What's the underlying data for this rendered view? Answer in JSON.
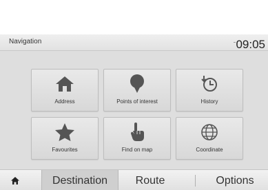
{
  "statusbar": {
    "title": "Navigation",
    "signal": "․․․",
    "time": "09:05"
  },
  "tiles": [
    {
      "label": "Address",
      "icon": "home-icon"
    },
    {
      "label": "Points of interest",
      "icon": "poi-marker-icon"
    },
    {
      "label": "History",
      "icon": "history-clock-icon"
    },
    {
      "label": "Favourites",
      "icon": "star-icon"
    },
    {
      "label": "Find on map",
      "icon": "pointing-hand-icon"
    },
    {
      "label": "Coordinate",
      "icon": "globe-icon"
    }
  ],
  "navbar": {
    "home_icon": "home-icon",
    "tabs": [
      "Destination",
      "Route",
      "Options"
    ],
    "active": "Destination"
  },
  "colors": {
    "icon": "#555555",
    "active_tab": "#cfcfcf",
    "background": "#dedede"
  }
}
